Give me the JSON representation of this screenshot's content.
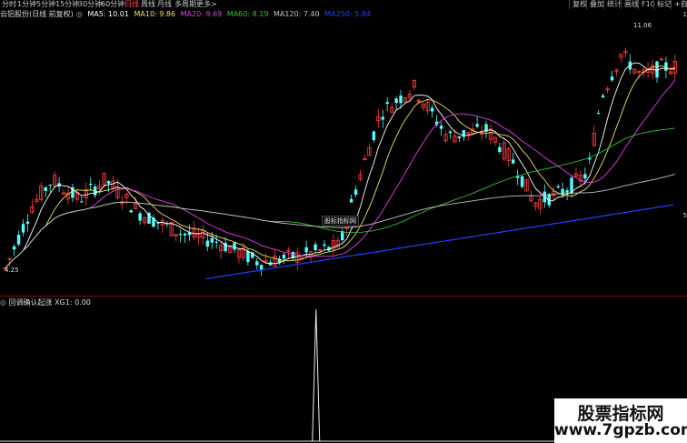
{
  "tabs": [
    "分时",
    "1分钟",
    "5分钟",
    "15分钟",
    "30分钟",
    "60分钟",
    "日线",
    "周线",
    "月线",
    "多周期",
    "更多>"
  ],
  "active_tab": "日线",
  "right_tabs": [
    "复权",
    "叠加",
    "统计",
    "画线",
    "F10",
    "标记",
    "+自"
  ],
  "legend": {
    "title": "云铝股份(日线 前复权)",
    "ma5": "MA5: 10.01",
    "ma10": "MA10: 9.86",
    "ma20": "MA20: 9.69",
    "ma60": "MA60: 8.19",
    "ma120": "MA120: 7.40",
    "ma250": "MA250: 5.84"
  },
  "colors": {
    "up": "#ff3c3c",
    "down": "#54ffff",
    "ma5": "#ffffff",
    "ma10": "#f0e060",
    "ma20": "#e040e0",
    "ma60": "#30c030",
    "ma120": "#c0c0c0",
    "ma250": "#2040ff"
  },
  "price_high_label": "11.06",
  "price_low_label": "4.25",
  "tooltip": "股标指标网",
  "right_edge_marks": [
    "1",
    "5"
  ],
  "indicator": {
    "title": "回调确认起涨",
    "value": "XG1: 0.00",
    "spike_index": 0.46
  },
  "watermark": {
    "line1": "股票指标网",
    "line2": "www.7gpzb.com"
  }
}
